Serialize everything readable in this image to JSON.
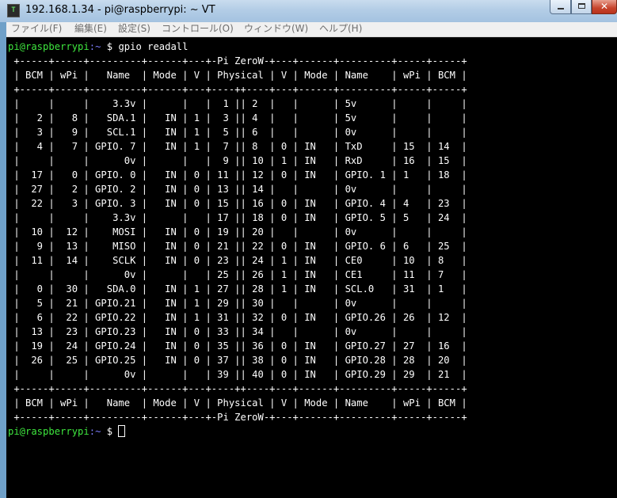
{
  "window": {
    "title": "192.168.1.34 - pi@raspberrypi: ~ VT",
    "app_icon_glyph": "T"
  },
  "menubar": {
    "items": [
      {
        "label": "ファイル(F)"
      },
      {
        "label": "編集(E)"
      },
      {
        "label": "設定(S)"
      },
      {
        "label": "コントロール(O)"
      },
      {
        "label": "ウィンドウ(W)"
      },
      {
        "label": "ヘルプ(H)"
      }
    ]
  },
  "terminal": {
    "prompt_user_host": "pi@raspberrypi",
    "prompt_dir": ":~ ",
    "prompt_symbol": "$ ",
    "command": "gpio readall",
    "lines": [
      " +-----+-----+---------+------+---+-Pi ZeroW-+---+------+---------+-----+-----+",
      " | BCM | wPi |   Name  | Mode | V | Physical | V | Mode | Name    | wPi | BCM |",
      " +-----+-----+---------+------+---+----++----+---+------+---------+-----+-----+",
      " |     |     |    3.3v |      |   |  1 || 2  |   |      | 5v      |     |     |",
      " |   2 |   8 |   SDA.1 |   IN | 1 |  3 || 4  |   |      | 5v      |     |     |",
      " |   3 |   9 |   SCL.1 |   IN | 1 |  5 || 6  |   |      | 0v      |     |     |",
      " |   4 |   7 | GPIO. 7 |   IN | 1 |  7 || 8  | 0 | IN   | TxD     | 15  | 14  |",
      " |     |     |      0v |      |   |  9 || 10 | 1 | IN   | RxD     | 16  | 15  |",
      " |  17 |   0 | GPIO. 0 |   IN | 0 | 11 || 12 | 0 | IN   | GPIO. 1 | 1   | 18  |",
      " |  27 |   2 | GPIO. 2 |   IN | 0 | 13 || 14 |   |      | 0v      |     |     |",
      " |  22 |   3 | GPIO. 3 |   IN | 0 | 15 || 16 | 0 | IN   | GPIO. 4 | 4   | 23  |",
      " |     |     |    3.3v |      |   | 17 || 18 | 0 | IN   | GPIO. 5 | 5   | 24  |",
      " |  10 |  12 |    MOSI |   IN | 0 | 19 || 20 |   |      | 0v      |     |     |",
      " |   9 |  13 |    MISO |   IN | 0 | 21 || 22 | 0 | IN   | GPIO. 6 | 6   | 25  |",
      " |  11 |  14 |    SCLK |   IN | 0 | 23 || 24 | 1 | IN   | CE0     | 10  | 8   |",
      " |     |     |      0v |      |   | 25 || 26 | 1 | IN   | CE1     | 11  | 7   |",
      " |   0 |  30 |   SDA.0 |   IN | 1 | 27 || 28 | 1 | IN   | SCL.0   | 31  | 1   |",
      " |   5 |  21 | GPIO.21 |   IN | 1 | 29 || 30 |   |      | 0v      |     |     |",
      " |   6 |  22 | GPIO.22 |   IN | 1 | 31 || 32 | 0 | IN   | GPIO.26 | 26  | 12  |",
      " |  13 |  23 | GPIO.23 |   IN | 0 | 33 || 34 |   |      | 0v      |     |     |",
      " |  19 |  24 | GPIO.24 |   IN | 0 | 35 || 36 | 0 | IN   | GPIO.27 | 27  | 16  |",
      " |  26 |  25 | GPIO.25 |   IN | 0 | 37 || 38 | 0 | IN   | GPIO.28 | 28  | 20  |",
      " |     |     |      0v |      |   | 39 || 40 | 0 | IN   | GPIO.29 | 29  | 21  |",
      " +-----+-----+---------+------+---+----++----+---+------+---------+-----+-----+",
      " | BCM | wPi |   Name  | Mode | V | Physical | V | Mode | Name    | wPi | BCM |",
      " +-----+-----+---------+------+---+-Pi ZeroW-+---+------+---------+-----+-----+"
    ]
  },
  "colors": {
    "terminal_background": "#000000",
    "terminal_foreground": "#ffffff",
    "prompt_user_host": "#3ee63e",
    "prompt_dir": "#7e7eff",
    "menu_text": "#6d6d6d"
  }
}
